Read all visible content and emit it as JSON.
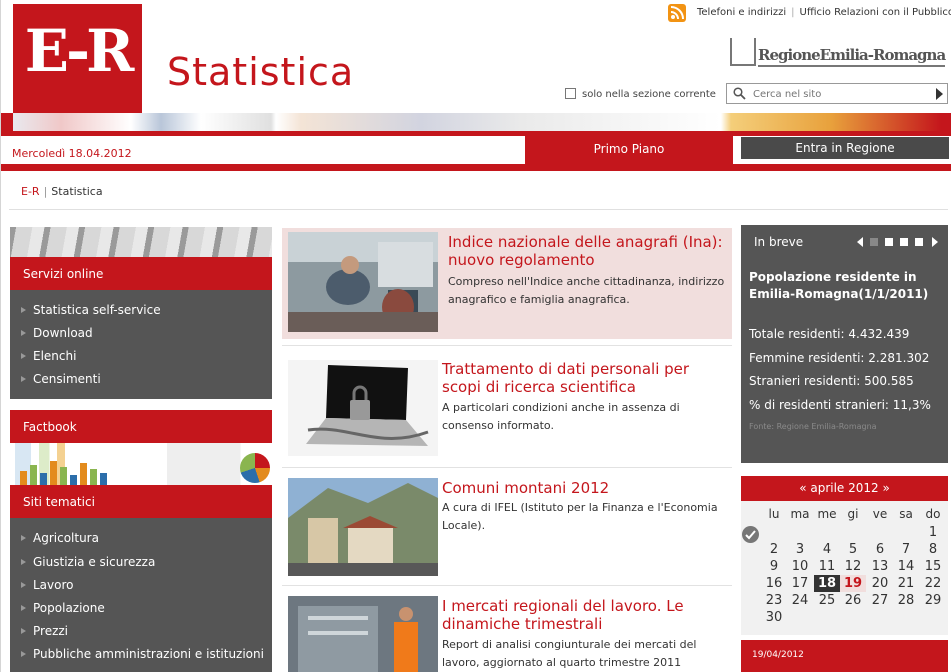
{
  "header": {
    "logo_text": "E-R",
    "site_title": "Statistica",
    "top_links": [
      "Telefoni e indirizzi",
      "Ufficio Relazioni con il Pubblico"
    ],
    "region_name": "RegioneEmilia-Romagna",
    "scope_label": "solo nella sezione corrente",
    "search_placeholder": "Cerca nel sito"
  },
  "date": "Mercoledì 18.04.2012",
  "tabs": [
    {
      "label": "Primo Piano",
      "active": true
    },
    {
      "label": "Entra in Regione",
      "active": false
    }
  ],
  "breadcrumb": {
    "home": "E-R",
    "current": "Statistica"
  },
  "sidebar": {
    "servizi": {
      "title": "Servizi online",
      "items": [
        "Statistica self-service",
        "Download",
        "Elenchi",
        "Censimenti"
      ]
    },
    "factbook": {
      "title": "Factbook"
    },
    "siti": {
      "title": "Siti tematici",
      "items": [
        "Agricoltura",
        "Giustizia e sicurezza",
        "Lavoro",
        "Popolazione",
        "Prezzi",
        "Pubbliche amministrazioni e istituzioni"
      ]
    }
  },
  "news": [
    {
      "title": "Indice nazionale delle anagrafi (Ina): nuovo regolamento",
      "desc": "Compreso nell'Indice anche cittadinanza, indirizzo anagrafico e famiglia anagrafica."
    },
    {
      "title": "Trattamento di dati personali per scopi di ricerca scientifica",
      "desc": "A particolari condizioni anche in assenza di consenso informato."
    },
    {
      "title": "Comuni montani 2012",
      "desc": "A cura di IFEL (Istituto per la Finanza e l'Economia Locale)."
    },
    {
      "title": "I mercati regionali del lavoro. Le dinamiche trimestrali",
      "desc": "Report di analisi congiunturale dei mercati del lavoro, aggiornato al quarto trimestre 2011"
    }
  ],
  "in_breve": {
    "title": "In breve",
    "headline": "Popolazione residente in Emilia-Romagna(1/1/2011)",
    "rows": [
      "Totale residenti: 4.432.439",
      "Femmine residenti: 2.281.302",
      "Stranieri residenti:  500.585",
      "% di residenti stranieri: 11,3%"
    ],
    "source": "Fonte: Regione Emilia-Romagna"
  },
  "calendar": {
    "month": "« aprile 2012 »",
    "days_of_week": [
      "lu",
      "ma",
      "me",
      "gi",
      "ve",
      "sa",
      "do"
    ],
    "weeks": [
      [
        "",
        "",
        "",
        "",
        "",
        "",
        "1"
      ],
      [
        "2",
        "3",
        "4",
        "5",
        "6",
        "7",
        "8"
      ],
      [
        "9",
        "10",
        "11",
        "12",
        "13",
        "14",
        "15"
      ],
      [
        "16",
        "17",
        "18",
        "19",
        "20",
        "21",
        "22"
      ],
      [
        "23",
        "24",
        "25",
        "26",
        "27",
        "28",
        "29"
      ],
      [
        "30",
        "",
        "",
        "",
        "",
        "",
        ""
      ]
    ],
    "today": "18",
    "selected": "19",
    "footer_date": "19/04/2012"
  },
  "colors": {
    "brand_red": "#c4161c",
    "dark_gray": "#555555",
    "light_pink": "#f1dedd"
  }
}
